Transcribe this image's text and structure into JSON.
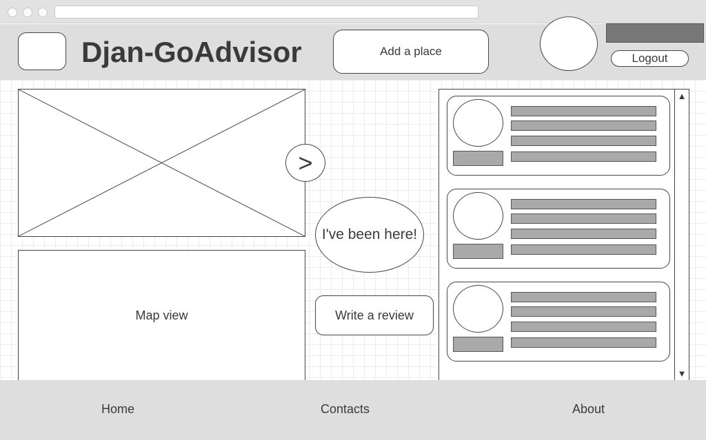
{
  "window": {
    "url_value": ""
  },
  "header": {
    "site_title": "Djan-GoAdvisor",
    "add_place_label": "Add a place",
    "logout_label": "Logout"
  },
  "gallery": {
    "next_label": ">"
  },
  "actions": {
    "been_here_label": "I've been here!",
    "write_review_label": "Write a review"
  },
  "map": {
    "label": "Map view"
  },
  "reviews": {
    "count": 3,
    "scroll_up_glyph": "▲",
    "scroll_down_glyph": "▼"
  },
  "footer": {
    "links": [
      "Home",
      "Contacts",
      "About"
    ]
  },
  "colors": {
    "chrome": "#e2e2e2",
    "header_bg": "#dedede",
    "placeholder_fill": "#a9a9a9",
    "user_bar": "#777777",
    "outline": "#444444"
  }
}
